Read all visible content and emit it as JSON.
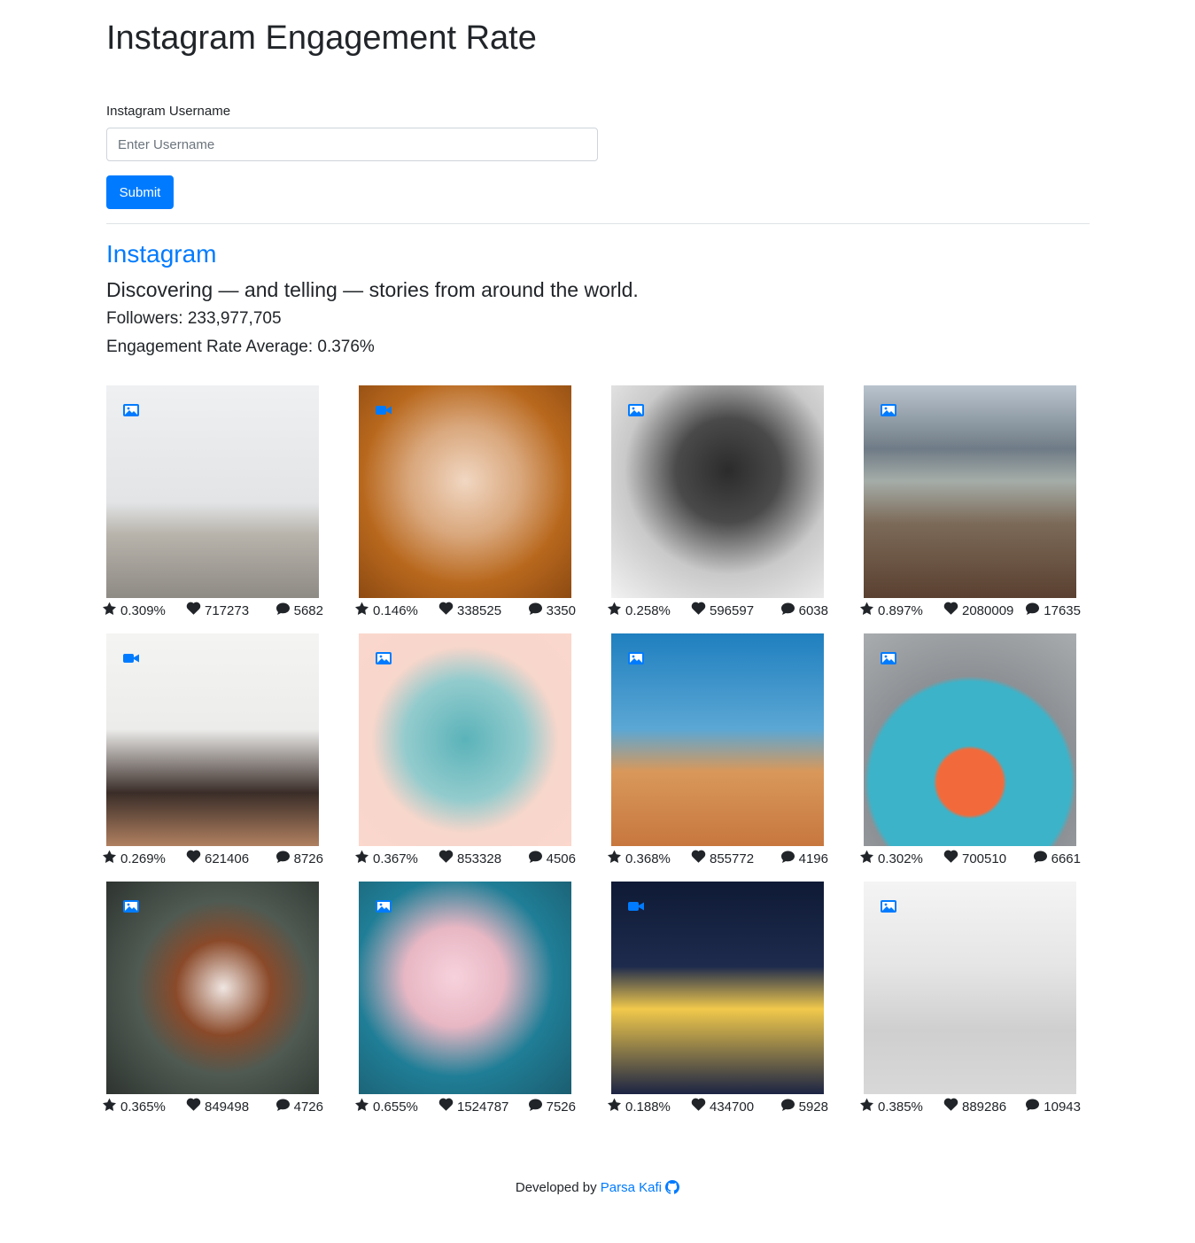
{
  "page": {
    "title": "Instagram Engagement Rate"
  },
  "form": {
    "label": "Instagram Username",
    "placeholder": "Enter Username",
    "value": "",
    "submit_label": "Submit"
  },
  "profile": {
    "name": "Instagram",
    "bio": "Discovering — and telling — stories from around the world.",
    "followers_text": "Followers: 233,977,705",
    "engagement_text": "Engagement Rate Average: 0.376%"
  },
  "posts": [
    {
      "type": "image-icon",
      "rate": "0.309%",
      "likes": "717273",
      "comments": "5682"
    },
    {
      "type": "video-icon",
      "rate": "0.146%",
      "likes": "338525",
      "comments": "3350"
    },
    {
      "type": "image-icon",
      "rate": "0.258%",
      "likes": "596597",
      "comments": "6038"
    },
    {
      "type": "image-icon",
      "rate": "0.897%",
      "likes": "2080009",
      "comments": "17635"
    },
    {
      "type": "video-icon",
      "rate": "0.269%",
      "likes": "621406",
      "comments": "8726"
    },
    {
      "type": "image-icon",
      "rate": "0.367%",
      "likes": "853328",
      "comments": "4506"
    },
    {
      "type": "image-icon",
      "rate": "0.368%",
      "likes": "855772",
      "comments": "4196"
    },
    {
      "type": "image-icon",
      "rate": "0.302%",
      "likes": "700510",
      "comments": "6661"
    },
    {
      "type": "image-icon",
      "rate": "0.365%",
      "likes": "849498",
      "comments": "4726"
    },
    {
      "type": "image-icon",
      "rate": "0.655%",
      "likes": "1524787",
      "comments": "7526"
    },
    {
      "type": "video-icon",
      "rate": "0.188%",
      "likes": "434700",
      "comments": "5928"
    },
    {
      "type": "image-icon",
      "rate": "0.385%",
      "likes": "889286",
      "comments": "10943"
    }
  ],
  "footer": {
    "prefix": "Developed by",
    "author": "Parsa Kafi"
  },
  "colors": {
    "accent": "#007bff",
    "text": "#212529",
    "border": "#ced4da",
    "divider": "#dee2e6"
  }
}
